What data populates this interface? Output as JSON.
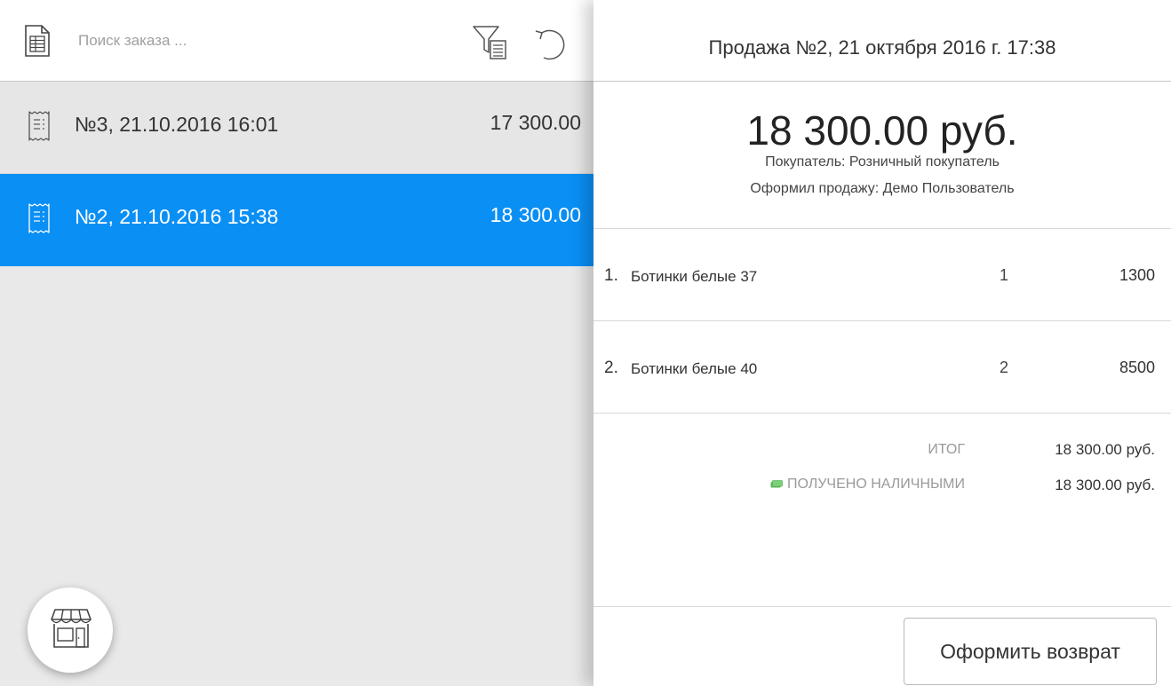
{
  "search": {
    "placeholder": "Поиск заказа ..."
  },
  "orders": [
    {
      "label": "№3, 21.10.2016 16:01",
      "amount": "17 300.00",
      "selected": false
    },
    {
      "label": "№2, 21.10.2016 15:38",
      "amount": "18 300.00",
      "selected": true
    }
  ],
  "sale": {
    "title": "Продажа №2, 21 октября 2016 г. 17:38",
    "total": "18 300.00 руб.",
    "customer": "Покупатель: Розничный покупатель",
    "seller": "Оформил продажу: Демо Пользователь",
    "items": [
      {
        "num": "1.",
        "name": "Ботинки белые 37",
        "qty": "1",
        "price": "1300"
      },
      {
        "num": "2.",
        "name": "Ботинки белые 40",
        "qty": "2",
        "price": "8500"
      }
    ],
    "summary": {
      "total_label": "ИТОГ",
      "total_value": "18 300.00 руб.",
      "cash_label": "ПОЛУЧЕНО НАЛИЧНЫМИ",
      "cash_value": "18 300.00 руб."
    },
    "return_button": "Оформить возврат"
  },
  "icons": {
    "header_left": "document-icon",
    "filter": "filter-icon",
    "refresh": "undo-icon",
    "order": "receipt-icon",
    "store": "store-icon",
    "cash": "cash-icon"
  },
  "colors": {
    "accent": "#0a8ff5",
    "left_bg": "#e9e9e9",
    "cash_green": "#5cb85c"
  }
}
